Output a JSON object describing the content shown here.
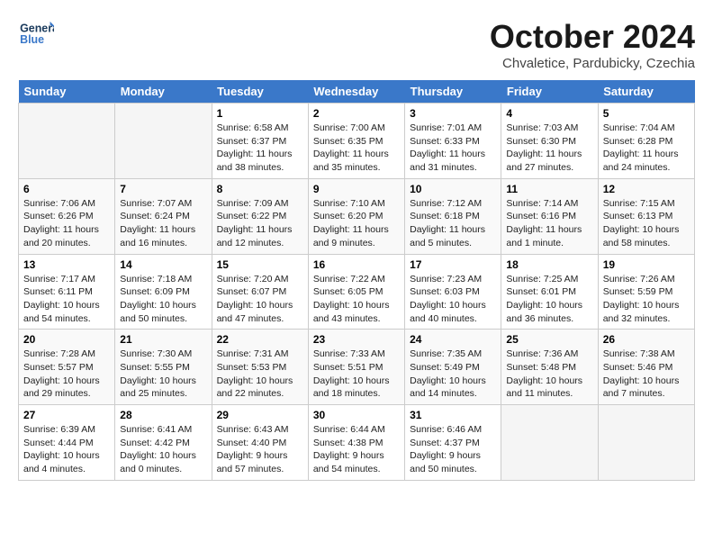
{
  "header": {
    "logo_line1": "General",
    "logo_line2": "Blue",
    "month_title": "October 2024",
    "subtitle": "Chvaletice, Pardubicky, Czechia"
  },
  "calendar": {
    "days_of_week": [
      "Sunday",
      "Monday",
      "Tuesday",
      "Wednesday",
      "Thursday",
      "Friday",
      "Saturday"
    ],
    "weeks": [
      [
        {
          "day": "",
          "sunrise": "",
          "sunset": "",
          "daylight": ""
        },
        {
          "day": "",
          "sunrise": "",
          "sunset": "",
          "daylight": ""
        },
        {
          "day": "1",
          "sunrise": "Sunrise: 6:58 AM",
          "sunset": "Sunset: 6:37 PM",
          "daylight": "Daylight: 11 hours and 38 minutes."
        },
        {
          "day": "2",
          "sunrise": "Sunrise: 7:00 AM",
          "sunset": "Sunset: 6:35 PM",
          "daylight": "Daylight: 11 hours and 35 minutes."
        },
        {
          "day": "3",
          "sunrise": "Sunrise: 7:01 AM",
          "sunset": "Sunset: 6:33 PM",
          "daylight": "Daylight: 11 hours and 31 minutes."
        },
        {
          "day": "4",
          "sunrise": "Sunrise: 7:03 AM",
          "sunset": "Sunset: 6:30 PM",
          "daylight": "Daylight: 11 hours and 27 minutes."
        },
        {
          "day": "5",
          "sunrise": "Sunrise: 7:04 AM",
          "sunset": "Sunset: 6:28 PM",
          "daylight": "Daylight: 11 hours and 24 minutes."
        }
      ],
      [
        {
          "day": "6",
          "sunrise": "Sunrise: 7:06 AM",
          "sunset": "Sunset: 6:26 PM",
          "daylight": "Daylight: 11 hours and 20 minutes."
        },
        {
          "day": "7",
          "sunrise": "Sunrise: 7:07 AM",
          "sunset": "Sunset: 6:24 PM",
          "daylight": "Daylight: 11 hours and 16 minutes."
        },
        {
          "day": "8",
          "sunrise": "Sunrise: 7:09 AM",
          "sunset": "Sunset: 6:22 PM",
          "daylight": "Daylight: 11 hours and 12 minutes."
        },
        {
          "day": "9",
          "sunrise": "Sunrise: 7:10 AM",
          "sunset": "Sunset: 6:20 PM",
          "daylight": "Daylight: 11 hours and 9 minutes."
        },
        {
          "day": "10",
          "sunrise": "Sunrise: 7:12 AM",
          "sunset": "Sunset: 6:18 PM",
          "daylight": "Daylight: 11 hours and 5 minutes."
        },
        {
          "day": "11",
          "sunrise": "Sunrise: 7:14 AM",
          "sunset": "Sunset: 6:16 PM",
          "daylight": "Daylight: 11 hours and 1 minute."
        },
        {
          "day": "12",
          "sunrise": "Sunrise: 7:15 AM",
          "sunset": "Sunset: 6:13 PM",
          "daylight": "Daylight: 10 hours and 58 minutes."
        }
      ],
      [
        {
          "day": "13",
          "sunrise": "Sunrise: 7:17 AM",
          "sunset": "Sunset: 6:11 PM",
          "daylight": "Daylight: 10 hours and 54 minutes."
        },
        {
          "day": "14",
          "sunrise": "Sunrise: 7:18 AM",
          "sunset": "Sunset: 6:09 PM",
          "daylight": "Daylight: 10 hours and 50 minutes."
        },
        {
          "day": "15",
          "sunrise": "Sunrise: 7:20 AM",
          "sunset": "Sunset: 6:07 PM",
          "daylight": "Daylight: 10 hours and 47 minutes."
        },
        {
          "day": "16",
          "sunrise": "Sunrise: 7:22 AM",
          "sunset": "Sunset: 6:05 PM",
          "daylight": "Daylight: 10 hours and 43 minutes."
        },
        {
          "day": "17",
          "sunrise": "Sunrise: 7:23 AM",
          "sunset": "Sunset: 6:03 PM",
          "daylight": "Daylight: 10 hours and 40 minutes."
        },
        {
          "day": "18",
          "sunrise": "Sunrise: 7:25 AM",
          "sunset": "Sunset: 6:01 PM",
          "daylight": "Daylight: 10 hours and 36 minutes."
        },
        {
          "day": "19",
          "sunrise": "Sunrise: 7:26 AM",
          "sunset": "Sunset: 5:59 PM",
          "daylight": "Daylight: 10 hours and 32 minutes."
        }
      ],
      [
        {
          "day": "20",
          "sunrise": "Sunrise: 7:28 AM",
          "sunset": "Sunset: 5:57 PM",
          "daylight": "Daylight: 10 hours and 29 minutes."
        },
        {
          "day": "21",
          "sunrise": "Sunrise: 7:30 AM",
          "sunset": "Sunset: 5:55 PM",
          "daylight": "Daylight: 10 hours and 25 minutes."
        },
        {
          "day": "22",
          "sunrise": "Sunrise: 7:31 AM",
          "sunset": "Sunset: 5:53 PM",
          "daylight": "Daylight: 10 hours and 22 minutes."
        },
        {
          "day": "23",
          "sunrise": "Sunrise: 7:33 AM",
          "sunset": "Sunset: 5:51 PM",
          "daylight": "Daylight: 10 hours and 18 minutes."
        },
        {
          "day": "24",
          "sunrise": "Sunrise: 7:35 AM",
          "sunset": "Sunset: 5:49 PM",
          "daylight": "Daylight: 10 hours and 14 minutes."
        },
        {
          "day": "25",
          "sunrise": "Sunrise: 7:36 AM",
          "sunset": "Sunset: 5:48 PM",
          "daylight": "Daylight: 10 hours and 11 minutes."
        },
        {
          "day": "26",
          "sunrise": "Sunrise: 7:38 AM",
          "sunset": "Sunset: 5:46 PM",
          "daylight": "Daylight: 10 hours and 7 minutes."
        }
      ],
      [
        {
          "day": "27",
          "sunrise": "Sunrise: 6:39 AM",
          "sunset": "Sunset: 4:44 PM",
          "daylight": "Daylight: 10 hours and 4 minutes."
        },
        {
          "day": "28",
          "sunrise": "Sunrise: 6:41 AM",
          "sunset": "Sunset: 4:42 PM",
          "daylight": "Daylight: 10 hours and 0 minutes."
        },
        {
          "day": "29",
          "sunrise": "Sunrise: 6:43 AM",
          "sunset": "Sunset: 4:40 PM",
          "daylight": "Daylight: 9 hours and 57 minutes."
        },
        {
          "day": "30",
          "sunrise": "Sunrise: 6:44 AM",
          "sunset": "Sunset: 4:38 PM",
          "daylight": "Daylight: 9 hours and 54 minutes."
        },
        {
          "day": "31",
          "sunrise": "Sunrise: 6:46 AM",
          "sunset": "Sunset: 4:37 PM",
          "daylight": "Daylight: 9 hours and 50 minutes."
        },
        {
          "day": "",
          "sunrise": "",
          "sunset": "",
          "daylight": ""
        },
        {
          "day": "",
          "sunrise": "",
          "sunset": "",
          "daylight": ""
        }
      ]
    ]
  }
}
